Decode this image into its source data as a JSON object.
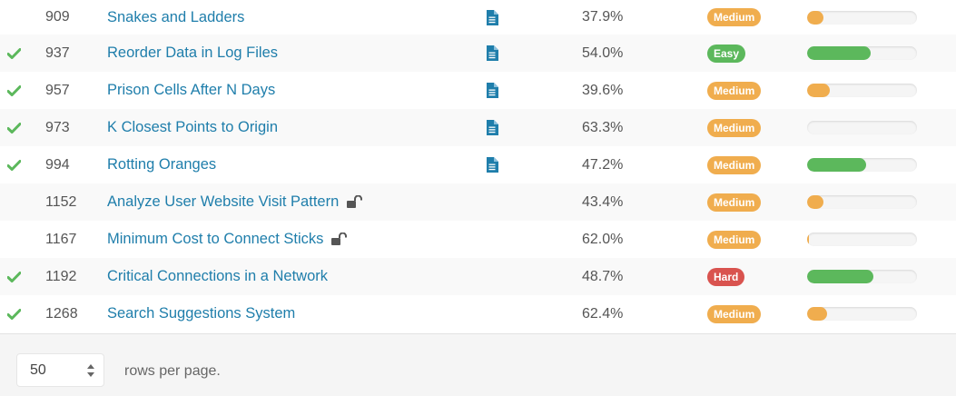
{
  "colors": {
    "link": "#1f7eab",
    "check": "#5cb85c",
    "doc_icon": "#1f7eab",
    "easy": "#5cb85c",
    "medium": "#f0ad4e",
    "hard": "#d9534f"
  },
  "problems": [
    {
      "solved": false,
      "id": "909",
      "title": "Snakes and Ladders",
      "locked": false,
      "has_solution": true,
      "acceptance": "37.9%",
      "difficulty": "Medium",
      "frequency": 0.15,
      "frequency_color": "#f0ad4e"
    },
    {
      "solved": true,
      "id": "937",
      "title": "Reorder Data in Log Files",
      "locked": false,
      "has_solution": true,
      "acceptance": "54.0%",
      "difficulty": "Easy",
      "frequency": 0.58,
      "frequency_color": "#5cb85c"
    },
    {
      "solved": true,
      "id": "957",
      "title": "Prison Cells After N Days",
      "locked": false,
      "has_solution": true,
      "acceptance": "39.6%",
      "difficulty": "Medium",
      "frequency": 0.21,
      "frequency_color": "#f0ad4e"
    },
    {
      "solved": true,
      "id": "973",
      "title": "K Closest Points to Origin",
      "locked": false,
      "has_solution": true,
      "acceptance": "63.3%",
      "difficulty": "Medium",
      "frequency": 0.0,
      "frequency_color": "#f0ad4e"
    },
    {
      "solved": true,
      "id": "994",
      "title": "Rotting Oranges",
      "locked": false,
      "has_solution": true,
      "acceptance": "47.2%",
      "difficulty": "Medium",
      "frequency": 0.54,
      "frequency_color": "#5cb85c"
    },
    {
      "solved": false,
      "id": "1152",
      "title": "Analyze User Website Visit Pattern",
      "locked": true,
      "has_solution": false,
      "acceptance": "43.4%",
      "difficulty": "Medium",
      "frequency": 0.15,
      "frequency_color": "#f0ad4e"
    },
    {
      "solved": false,
      "id": "1167",
      "title": "Minimum Cost to Connect Sticks",
      "locked": true,
      "has_solution": false,
      "acceptance": "62.0%",
      "difficulty": "Medium",
      "frequency": 0.02,
      "frequency_color": "#f0ad4e"
    },
    {
      "solved": true,
      "id": "1192",
      "title": "Critical Connections in a Network",
      "locked": false,
      "has_solution": false,
      "acceptance": "48.7%",
      "difficulty": "Hard",
      "frequency": 0.6,
      "frequency_color": "#5cb85c"
    },
    {
      "solved": true,
      "id": "1268",
      "title": "Search Suggestions System",
      "locked": false,
      "has_solution": false,
      "acceptance": "62.4%",
      "difficulty": "Medium",
      "frequency": 0.18,
      "frequency_color": "#f0ad4e"
    }
  ],
  "pagination": {
    "rows_per_page_value": "50",
    "rows_per_page_label": "rows per page."
  }
}
